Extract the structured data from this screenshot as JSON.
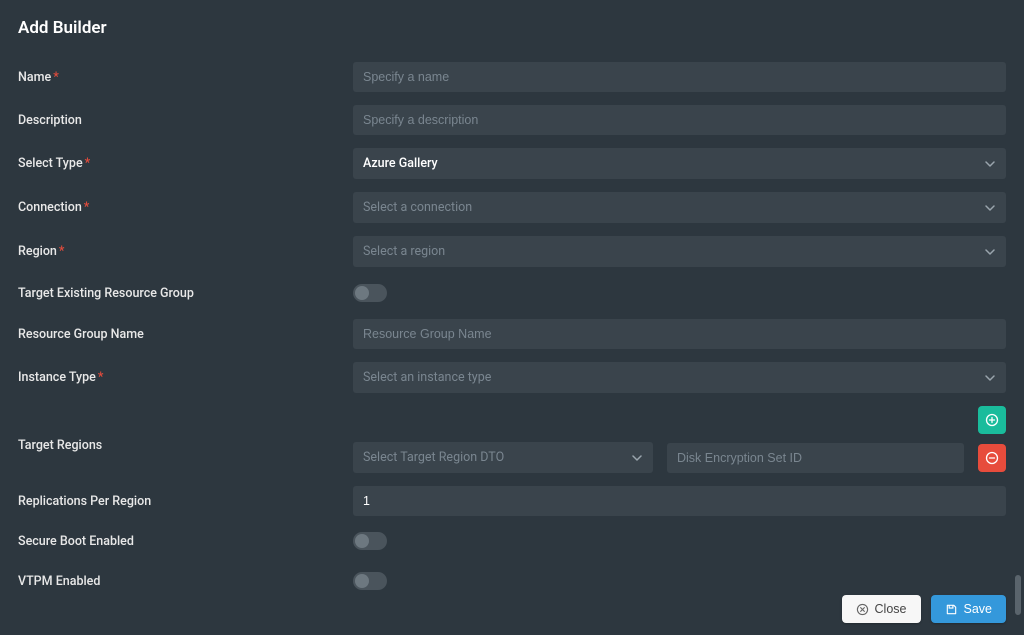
{
  "title": "Add Builder",
  "fields": {
    "name": {
      "label": "Name",
      "required": true,
      "placeholder": "Specify a name"
    },
    "description": {
      "label": "Description",
      "required": false,
      "placeholder": "Specify a description"
    },
    "selectType": {
      "label": "Select Type",
      "required": true,
      "value": "Azure Gallery"
    },
    "connection": {
      "label": "Connection",
      "required": true,
      "placeholder": "Select a connection"
    },
    "region": {
      "label": "Region",
      "required": true,
      "placeholder": "Select a region"
    },
    "targetExisting": {
      "label": "Target Existing Resource Group",
      "value": false
    },
    "resourceGroupName": {
      "label": "Resource Group Name",
      "placeholder": "Resource Group Name"
    },
    "instanceType": {
      "label": "Instance Type",
      "required": true,
      "placeholder": "Select an instance type"
    },
    "targetRegions": {
      "label": "Target Regions",
      "dtoPlaceholder": "Select Target Region DTO",
      "diskPlaceholder": "Disk Encryption Set ID"
    },
    "replications": {
      "label": "Replications Per Region",
      "value": "1"
    },
    "secureBoot": {
      "label": "Secure Boot Enabled",
      "value": false
    },
    "vtpm": {
      "label": "VTPM Enabled",
      "value": false
    }
  },
  "buttons": {
    "close": "Close",
    "save": "Save"
  }
}
